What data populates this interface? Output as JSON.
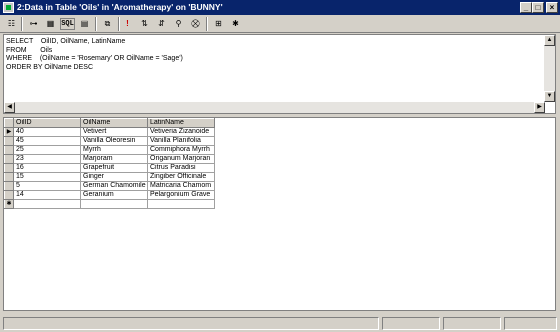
{
  "window": {
    "title": "2:Data in Table 'Oils' in 'Aromatherapy' on 'BUNNY'",
    "controls": [
      "_",
      "□",
      "×"
    ]
  },
  "toolbar": {
    "icons": [
      "properties-icon",
      "link-icon",
      "grid-icon",
      "sql-icon",
      "results-icon",
      "pane-icon",
      "run-icon",
      "sort-asc-icon",
      "sort-desc-icon",
      "filter-icon",
      "remove-filter-icon",
      "group-by-icon",
      "add-table-icon"
    ],
    "sql_label": "SQL"
  },
  "sql": {
    "text": "SELECT    OilID, OilName, LatinName\nFROM       Oils\nWHERE    (OilName = 'Rosemary' OR OilName = 'Sage')\nORDER BY OilName DESC"
  },
  "grid": {
    "columns": [
      "OilID",
      "OilName",
      "LatinName"
    ],
    "rows": [
      [
        "40",
        "Vetivert",
        "Vetiveria Zizanoide"
      ],
      [
        "45",
        "Vanilla Oleoresin",
        "Vanilla Planifolia"
      ],
      [
        "25",
        "Myrrh",
        "Commiphora Myrrh"
      ],
      [
        "23",
        "Marjoram",
        "Origanum Marjoran"
      ],
      [
        "16",
        "Grapefruit",
        "Citrus Paradisi"
      ],
      [
        "15",
        "Ginger",
        "Zingiber Officinale"
      ],
      [
        "5",
        "German Chamomile",
        "Matricaria Chamom"
      ],
      [
        "14",
        "Geranium",
        "Pelargonium Grave"
      ]
    ],
    "current_row_marker": "▶",
    "new_row_marker": "✱"
  }
}
